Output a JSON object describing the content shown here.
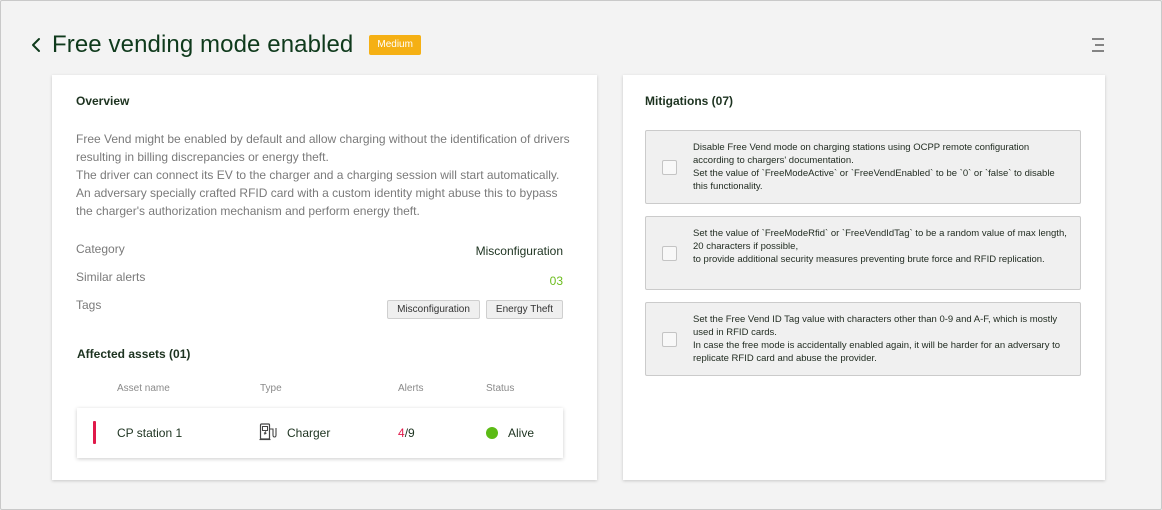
{
  "header": {
    "title": "Free vending mode enabled",
    "severity": "Medium",
    "back_icon": "chevron-left-icon",
    "menu_icon": "menu-icon"
  },
  "colors": {
    "severity": "#f5b014",
    "accent_green": "#6cbd1e",
    "alert_red": "#e0194a",
    "status_alive": "#5cbb15"
  },
  "overview": {
    "title": "Overview",
    "description": [
      "Free Vend might be enabled by default and allow charging without the identification of drivers resulting in billing discrepancies or energy theft.",
      "The driver can connect its EV to the charger and a charging session will start automatically. An adversary specially crafted RFID card with a custom identity might abuse this to bypass the charger's authorization mechanism and perform energy theft."
    ],
    "category_label": "Category",
    "category_value": "Misconfiguration",
    "similar_label": "Similar alerts",
    "similar_value": "03",
    "tags_label": "Tags",
    "tags": [
      "Misconfiguration",
      "Energy Theft"
    ]
  },
  "assets": {
    "title": "Affected assets (01)",
    "columns": [
      "Asset name",
      "Type",
      "Alerts",
      "Status"
    ],
    "rows": [
      {
        "name": "CP station 1",
        "type": "Charger",
        "type_icon": "charger-icon",
        "alerts_active": "4",
        "alerts_total": "/9",
        "status": "Alive"
      }
    ]
  },
  "mitigations": {
    "title": "Mitigations (07)",
    "items": [
      {
        "lines": [
          "Disable Free Vend mode on charging stations using OCPP remote configuration according to chargers' documentation.",
          "Set the value of `FreeModeActive` or `FreeVendEnabled` to be `0` or `false` to disable this functionality."
        ]
      },
      {
        "lines": [
          "Set the value of `FreeModeRfid` or `FreeVendIdTag` to be a random value of max length, 20 characters if possible,",
          "to provide additional security measures preventing brute force and RFID replication."
        ]
      },
      {
        "lines": [
          "Set the Free Vend ID Tag value with characters other than 0-9 and A-F, which is mostly used in RFID cards.",
          "In case the free mode is accidentally enabled again, it will be harder for an adversary to replicate RFID card and abuse the provider."
        ]
      }
    ]
  }
}
